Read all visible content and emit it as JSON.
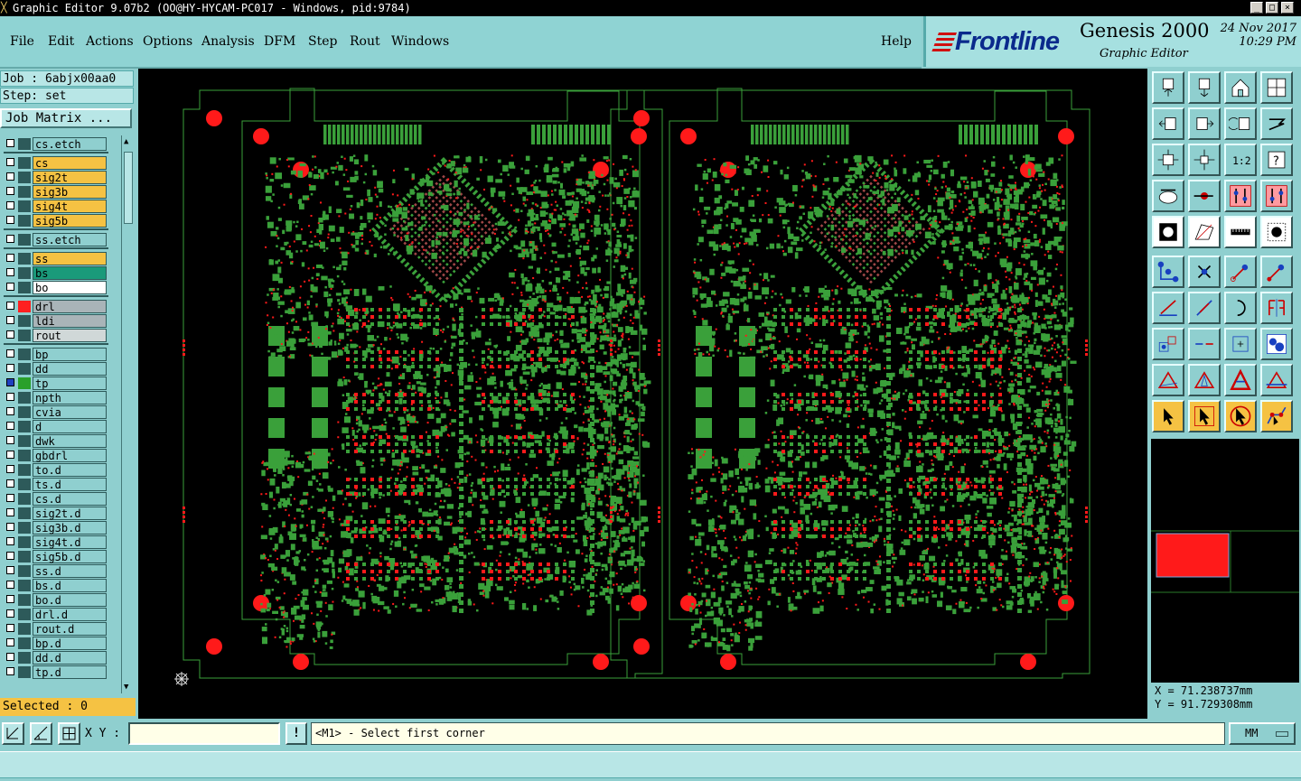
{
  "window": {
    "title": "Graphic Editor 9.07b2 (OO@HY-HYCAM-PC017 - Windows, pid:9784)"
  },
  "menu": [
    {
      "label": "File"
    },
    {
      "label": "Edit"
    },
    {
      "label": "Actions"
    },
    {
      "label": "Options"
    },
    {
      "label": "Analysis"
    },
    {
      "label": "DFM"
    },
    {
      "label": "Step"
    },
    {
      "label": "Rout"
    },
    {
      "label": "Windows"
    },
    {
      "label": "Help"
    }
  ],
  "brand": {
    "logo": "Frontline",
    "product": "Genesis 2000",
    "subtitle": "Graphic Editor",
    "date": "24 Nov 2017",
    "time": "10:29 PM"
  },
  "job": {
    "job_label": "Job : 6abjx00aa0",
    "step_label": "Step: set",
    "matrix_button": "Job Matrix ..."
  },
  "layers": [
    {
      "name": "cs.etch",
      "color": "#8fcfcf",
      "swatch": "#2d5a5a"
    },
    {
      "name": "cs",
      "color": "#f5c243",
      "swatch": "#2d5a5a"
    },
    {
      "name": "sig2t",
      "color": "#f5c243",
      "swatch": "#2d5a5a"
    },
    {
      "name": "sig3b",
      "color": "#f5c243",
      "swatch": "#2d5a5a"
    },
    {
      "name": "sig4t",
      "color": "#f5c243",
      "swatch": "#2d5a5a"
    },
    {
      "name": "sig5b",
      "color": "#f5c243",
      "swatch": "#2d5a5a"
    },
    {
      "name": "ss.etch",
      "color": "#8fcfcf",
      "swatch": "#2d5a5a"
    },
    {
      "name": "ss",
      "color": "#f5c243",
      "swatch": "#2d5a5a"
    },
    {
      "name": "bs",
      "color": "#1a9a7a",
      "swatch": "#2d5a5a"
    },
    {
      "name": "bo",
      "color": "#ffffff",
      "swatch": "#2d5a5a"
    },
    {
      "name": "drl",
      "color": "#a9b4b8",
      "swatch": "#ff2020"
    },
    {
      "name": "ldi",
      "color": "#a9b4b8",
      "swatch": "#2d5a5a"
    },
    {
      "name": "rout",
      "color": "#d0d8d8",
      "swatch": "#2d5a5a"
    },
    {
      "name": "bp",
      "color": "#8fcfcf",
      "swatch": "#2d5a5a"
    },
    {
      "name": "dd",
      "color": "#8fcfcf",
      "swatch": "#2d5a5a"
    },
    {
      "name": "tp",
      "color": "#8fcfcf",
      "swatch": "#2aa02a"
    },
    {
      "name": "npth",
      "color": "#8fcfcf",
      "swatch": "#2d5a5a"
    },
    {
      "name": "cvia",
      "color": "#8fcfcf",
      "swatch": "#2d5a5a"
    },
    {
      "name": "d",
      "color": "#8fcfcf",
      "swatch": "#2d5a5a"
    },
    {
      "name": "dwk",
      "color": "#8fcfcf",
      "swatch": "#2d5a5a"
    },
    {
      "name": "gbdrl",
      "color": "#8fcfcf",
      "swatch": "#2d5a5a"
    },
    {
      "name": "to.d",
      "color": "#8fcfcf",
      "swatch": "#2d5a5a"
    },
    {
      "name": "ts.d",
      "color": "#8fcfcf",
      "swatch": "#2d5a5a"
    },
    {
      "name": "cs.d",
      "color": "#8fcfcf",
      "swatch": "#2d5a5a"
    },
    {
      "name": "sig2t.d",
      "color": "#8fcfcf",
      "swatch": "#2d5a5a"
    },
    {
      "name": "sig3b.d",
      "color": "#8fcfcf",
      "swatch": "#2d5a5a"
    },
    {
      "name": "sig4t.d",
      "color": "#8fcfcf",
      "swatch": "#2d5a5a"
    },
    {
      "name": "sig5b.d",
      "color": "#8fcfcf",
      "swatch": "#2d5a5a"
    },
    {
      "name": "ss.d",
      "color": "#8fcfcf",
      "swatch": "#2d5a5a"
    },
    {
      "name": "bs.d",
      "color": "#8fcfcf",
      "swatch": "#2d5a5a"
    },
    {
      "name": "bo.d",
      "color": "#8fcfcf",
      "swatch": "#2d5a5a"
    },
    {
      "name": "drl.d",
      "color": "#8fcfcf",
      "swatch": "#2d5a5a"
    },
    {
      "name": "rout.d",
      "color": "#8fcfcf",
      "swatch": "#2d5a5a"
    },
    {
      "name": "bp.d",
      "color": "#8fcfcf",
      "swatch": "#2d5a5a"
    },
    {
      "name": "dd.d",
      "color": "#8fcfcf",
      "swatch": "#2d5a5a"
    },
    {
      "name": "tp.d",
      "color": "#8fcfcf",
      "swatch": "#2d5a5a"
    }
  ],
  "selected": {
    "label": "Selected : 0"
  },
  "coords": {
    "x": "X = 71.238737mm",
    "y": "Y = 91.729308mm"
  },
  "bottom": {
    "xy_label": "X Y :",
    "xy_value": "",
    "warn": "!",
    "prompt": "<M1> - Select first corner",
    "units": "MM"
  },
  "colors": {
    "board_outline": "#3aa03a",
    "pads": "#3aa03a",
    "holes": "#ff1a1a",
    "canvas": "#000000",
    "accent": "#f5c243"
  },
  "toolbar_icons": [
    "pan-up-icon",
    "pan-down-icon",
    "home-icon",
    "window-icon",
    "pan-left-icon",
    "pan-right-icon",
    "undo-view-icon",
    "redraw-icon",
    "zoom-fit-icon",
    "zoom-home-icon",
    "one-to-one-icon",
    "help-icon",
    "snap-icon",
    "measure-icon",
    "drc-icon",
    "drc2-icon",
    "fill-icon",
    "polygon-icon",
    "ruler-icon",
    "circle-icon",
    "connect-icon",
    "cross-icon",
    "move-icon",
    "copy-icon",
    "line-icon",
    "line2-icon",
    "arc-icon",
    "mirror-icon",
    "pad-icon",
    "split-icon",
    "box-icon",
    "group-icon",
    "triangle-icon",
    "triangle2-icon",
    "triangle3-icon",
    "triangle4-icon",
    "pointer-icon",
    "select-icon",
    "select2-icon",
    "net-icon"
  ]
}
